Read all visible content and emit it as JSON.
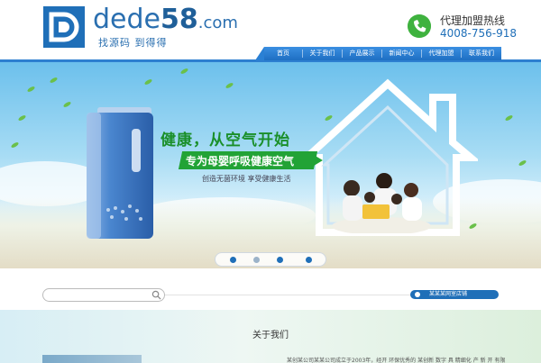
{
  "logo": {
    "word_part1": "dede",
    "word_part2": "58",
    "word_part3": ".com",
    "slogan": "找源码 到得得"
  },
  "hotline": {
    "title": "代理加盟热线",
    "number": "4008-756-918"
  },
  "nav": {
    "items": [
      "首页",
      "关于我们",
      "产品展示",
      "新闻中心",
      "代理加盟",
      "联系我们"
    ]
  },
  "banner": {
    "headline": "健康，从空气开始",
    "subhead": "专为母婴呼吸健康空气",
    "tagline": "创造无菌环境 享受健康生活"
  },
  "search": {
    "placeholder": ""
  },
  "store_button": {
    "label": "某某某网室店铺"
  },
  "about": {
    "title": "关于我们",
    "text": "某创某公司某某公司成立于2003年，经开 环保优秀的 某创新 数字 具 精细化 产 新 开 有限"
  },
  "colors": {
    "brand_blue": "#1f6fb8",
    "accent_green": "#22a336"
  }
}
